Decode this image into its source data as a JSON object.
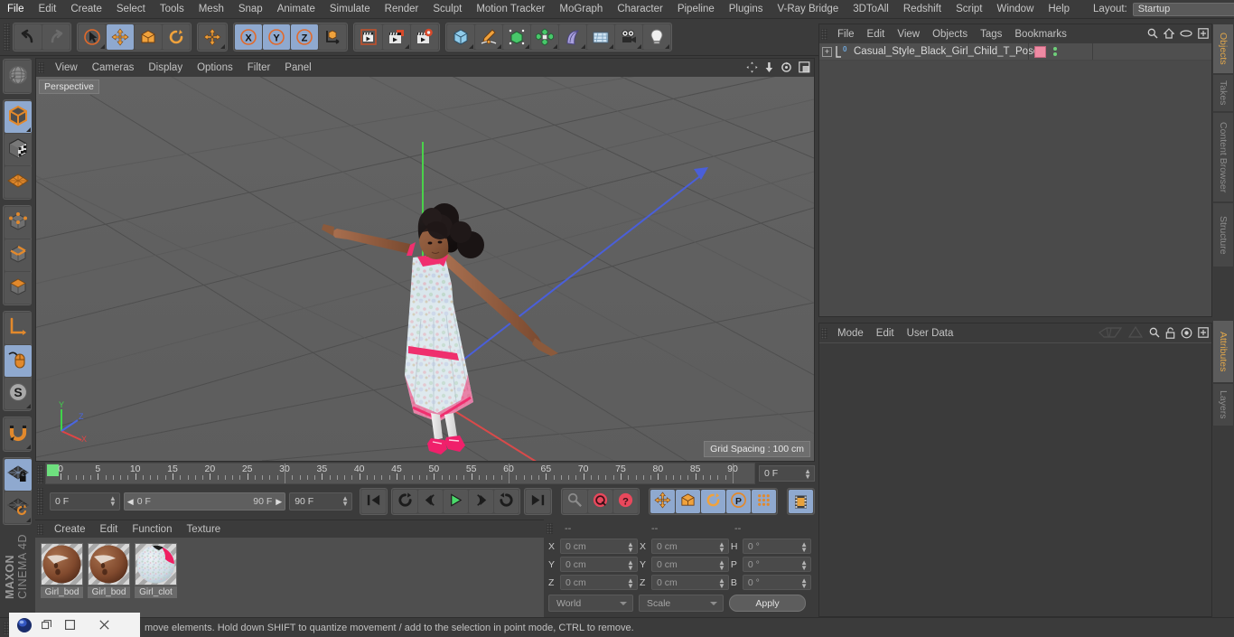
{
  "menubar": {
    "items": [
      "File",
      "Edit",
      "Create",
      "Select",
      "Tools",
      "Mesh",
      "Snap",
      "Animate",
      "Simulate",
      "Render",
      "Sculpt",
      "Motion Tracker",
      "MoGraph",
      "Character",
      "Pipeline",
      "Plugins",
      "V-Ray Bridge",
      "3DToAll",
      "Redshift",
      "Script",
      "Window",
      "Help"
    ],
    "layout_label": "Layout:",
    "layout_value": "Startup",
    "search_icon": "search-icon"
  },
  "toolbar": {
    "groups": [
      {
        "name": "undo-redo",
        "buttons": [
          {
            "name": "undo-button",
            "icon": "undo-arrow-icon",
            "selected": false,
            "corner": false
          },
          {
            "name": "redo-button",
            "icon": "redo-arrow-icon",
            "selected": false,
            "corner": false
          }
        ]
      },
      {
        "name": "transform-tools",
        "buttons": [
          {
            "name": "live-selection-tool",
            "icon": "cursor-circle-icon",
            "selected": false,
            "corner": true
          },
          {
            "name": "move-tool",
            "icon": "move-arrows-icon",
            "selected": true,
            "corner": false
          },
          {
            "name": "scale-tool",
            "icon": "scale-box-icon",
            "selected": false,
            "corner": false
          },
          {
            "name": "rotate-tool",
            "icon": "rotate-arc-icon",
            "selected": false,
            "corner": false
          }
        ]
      },
      {
        "name": "move-dup",
        "buttons": [
          {
            "name": "move-tool-secondary",
            "icon": "move-arrows-icon",
            "selected": false,
            "corner": true
          }
        ]
      },
      {
        "name": "axis-locks",
        "buttons": [
          {
            "name": "lock-x-axis-button",
            "icon": "x-axis-icon",
            "selected": true,
            "corner": false
          },
          {
            "name": "lock-y-axis-button",
            "icon": "y-axis-icon",
            "selected": true,
            "corner": false
          },
          {
            "name": "lock-z-axis-button",
            "icon": "z-axis-icon",
            "selected": true,
            "corner": false
          },
          {
            "name": "world-object-coord-button",
            "icon": "world-axis-cube-icon",
            "selected": false,
            "corner": false
          }
        ]
      },
      {
        "name": "render-tools",
        "buttons": [
          {
            "name": "render-view-button",
            "icon": "clapper-view-icon",
            "selected": false,
            "corner": false
          },
          {
            "name": "render-to-picture-viewer-button",
            "icon": "clapper-picture-icon",
            "selected": false,
            "corner": true
          },
          {
            "name": "render-settings-button",
            "icon": "clapper-gear-icon",
            "selected": false,
            "corner": false
          }
        ]
      },
      {
        "name": "creation-tools",
        "buttons": [
          {
            "name": "add-cube-button",
            "icon": "blue-cube-icon",
            "selected": false,
            "corner": true
          },
          {
            "name": "add-spline-button",
            "icon": "pen-spline-icon",
            "selected": false,
            "corner": true
          },
          {
            "name": "add-generator-button",
            "icon": "green-cube-generator-icon",
            "selected": false,
            "corner": true
          },
          {
            "name": "add-modeling-object-button",
            "icon": "green-array-icon",
            "selected": false,
            "corner": true
          },
          {
            "name": "add-deformer-button",
            "icon": "purple-bend-icon",
            "selected": false,
            "corner": true
          },
          {
            "name": "add-environment-button",
            "icon": "grid-floor-icon",
            "selected": false,
            "corner": true
          },
          {
            "name": "add-camera-button",
            "icon": "camera-icon",
            "selected": false,
            "corner": true
          },
          {
            "name": "add-light-button",
            "icon": "lightbulb-icon",
            "selected": false,
            "corner": true
          }
        ]
      }
    ]
  },
  "leftbar": {
    "groups": [
      {
        "name": "viewport-nav-group",
        "buttons": [
          {
            "name": "undo-view-button",
            "icon": "globe-wire-icon",
            "selected": false,
            "corner": false
          }
        ]
      },
      {
        "name": "editor-mode-group",
        "buttons": [
          {
            "name": "make-editable-button",
            "icon": "orange-cube-convert-icon",
            "selected": true,
            "corner": true
          },
          {
            "name": "texture-mode-button",
            "icon": "checker-cube-icon",
            "selected": false,
            "corner": false
          },
          {
            "name": "viewport-solo-button",
            "icon": "orange-plane-grid-icon",
            "selected": false,
            "corner": false
          }
        ]
      },
      {
        "name": "component-mode-group",
        "buttons": [
          {
            "name": "points-mode-button",
            "icon": "points-cube-icon",
            "selected": false,
            "corner": false
          },
          {
            "name": "edges-mode-button",
            "icon": "edges-cube-icon",
            "selected": false,
            "corner": false
          },
          {
            "name": "polygons-mode-button",
            "icon": "polygons-cube-icon",
            "selected": false,
            "corner": false
          }
        ]
      },
      {
        "name": "axis-group",
        "buttons": [
          {
            "name": "enable-axis-modification-button",
            "icon": "axis-L-icon",
            "selected": false,
            "corner": false
          },
          {
            "name": "viewport-solo-mouse-button",
            "icon": "mouse-icon",
            "selected": true,
            "corner": false
          },
          {
            "name": "soft-selection-button",
            "icon": "s-circle-icon",
            "selected": false,
            "corner": true
          }
        ]
      },
      {
        "name": "snap-group",
        "buttons": [
          {
            "name": "enable-snap-button",
            "icon": "magnet-icon",
            "selected": false,
            "corner": true
          }
        ]
      },
      {
        "name": "workplane-group",
        "buttons": [
          {
            "name": "lock-workplane-button",
            "icon": "workplane-lock-icon",
            "selected": true,
            "corner": false
          },
          {
            "name": "reset-workplane-button",
            "icon": "workplane-reset-icon",
            "selected": false,
            "corner": true
          }
        ]
      }
    ],
    "brand_line1": "MAXON",
    "brand_line2": "CINEMA 4D"
  },
  "viewport": {
    "menu_items": [
      "View",
      "Cameras",
      "Display",
      "Options",
      "Filter",
      "Panel"
    ],
    "label": "Perspective",
    "grid_spacing": "Grid Spacing : 100 cm",
    "axis_labels": {
      "x": "X",
      "y": "Y",
      "z": "Z"
    },
    "corner_icons": [
      "pan-icon",
      "zoom-icon",
      "orbit-icon",
      "maximize-viewport-icon"
    ]
  },
  "timeline": {
    "ticks": [
      0,
      5,
      10,
      15,
      20,
      25,
      30,
      35,
      40,
      45,
      50,
      55,
      60,
      65,
      70,
      75,
      80,
      85,
      90
    ],
    "current_frame_field": "0 F",
    "current_frame_field_right": "0 F",
    "range_start": "0 F",
    "range_end": "90 F",
    "end_frame_field": "90 F",
    "transport": [
      {
        "name": "go-to-start-button",
        "icon": "skip-start-icon",
        "selected": false
      },
      {
        "name": "play-backwards-loop-button",
        "icon": "loop-back-icon",
        "selected": false
      },
      {
        "name": "step-back-button",
        "icon": "step-back-icon",
        "selected": false
      },
      {
        "name": "play-button",
        "icon": "play-icon",
        "selected": false
      },
      {
        "name": "step-forward-button",
        "icon": "step-forward-icon",
        "selected": false
      },
      {
        "name": "play-forward-loop-button",
        "icon": "loop-forward-icon",
        "selected": false
      },
      {
        "name": "go-to-end-button",
        "icon": "skip-end-icon",
        "selected": false
      }
    ],
    "keyframe_buttons": [
      {
        "name": "record-active-objects-button",
        "icon": "key-icon",
        "selected": false
      },
      {
        "name": "autokeying-button",
        "icon": "red-circle-key-icon",
        "selected": false
      },
      {
        "name": "keyframe-selection-button",
        "icon": "red-question-key-icon",
        "selected": false
      }
    ],
    "key_filter_buttons": [
      {
        "name": "position-key-button",
        "icon": "move-arrows-icon",
        "selected": true
      },
      {
        "name": "scale-key-button",
        "icon": "scale-box-icon",
        "selected": true
      },
      {
        "name": "rotation-key-button",
        "icon": "rotate-arc-icon",
        "selected": true
      },
      {
        "name": "parameter-key-button",
        "icon": "p-circle-icon",
        "selected": true
      },
      {
        "name": "point-level-animation-button",
        "icon": "dots-grid-icon",
        "selected": true
      }
    ],
    "timeline_toggle": {
      "name": "toggle-timeline-button",
      "icon": "filmstrip-icon",
      "selected": true
    }
  },
  "material_manager": {
    "menu_items": [
      "Create",
      "Edit",
      "Function",
      "Texture"
    ],
    "materials": [
      {
        "name": "Girl_bod",
        "type": "skin"
      },
      {
        "name": "Girl_bod",
        "type": "skin"
      },
      {
        "name": "Girl_clot",
        "type": "cloth"
      }
    ]
  },
  "coordinates": {
    "headers": [
      "--",
      "--",
      "--"
    ],
    "rows": [
      {
        "label_pos": "X",
        "value_pos": "0 cm",
        "label_size": "X",
        "value_size": "0 cm",
        "label_rot": "H",
        "value_rot": "0 °"
      },
      {
        "label_pos": "Y",
        "value_pos": "0 cm",
        "label_size": "Y",
        "value_size": "0 cm",
        "label_rot": "P",
        "value_rot": "0 °"
      },
      {
        "label_pos": "Z",
        "value_pos": "0 cm",
        "label_size": "Z",
        "value_size": "0 cm",
        "label_rot": "B",
        "value_rot": "0 °"
      }
    ],
    "coord_system": "World",
    "transform_mode": "Scale",
    "apply_label": "Apply"
  },
  "object_manager": {
    "menu_items": [
      "File",
      "Edit",
      "View",
      "Objects",
      "Tags",
      "Bookmarks"
    ],
    "icons": [
      "search-icon",
      "home-icon",
      "ellipse-icon",
      "add-layer-icon"
    ],
    "objects": [
      {
        "name": "Casual_Style_Black_Girl_Child_T_Pose",
        "expandable": true,
        "tag_color": "#ef8aa3"
      }
    ]
  },
  "attributes": {
    "menu_items": [
      "Mode",
      "Edit",
      "User Data"
    ],
    "icons": [
      "prev-attr-icon",
      "next-attr-icon",
      "search-icon",
      "lock-icon",
      "target-icon",
      "add-tab-icon"
    ]
  },
  "right_tabs_top": [
    {
      "label": "Objects",
      "active": true
    },
    {
      "label": "Takes",
      "active": false
    },
    {
      "label": "Content Browser",
      "active": false
    },
    {
      "label": "Structure",
      "active": false
    }
  ],
  "right_tabs_bottom": [
    {
      "label": "Attributes",
      "active": true
    },
    {
      "label": "Layers",
      "active": false
    }
  ],
  "statusbar": {
    "text": "move elements. Hold down SHIFT to quantize movement / add to the selection in point mode, CTRL to remove."
  },
  "taskbar": {
    "app_icon": "cinema4d-app-icon",
    "restore_icon": "restore-window-icon",
    "maximize_icon": "maximize-window-icon",
    "close_icon": "close-window-icon"
  },
  "colors": {
    "accent_orange": "#e0a64b",
    "selected_blue": "#8fa9cf",
    "panel_bg": "#3b3b3b",
    "viewport_bg": "#616161",
    "axis_x": "#d94a4a",
    "axis_y": "#4ad14a",
    "axis_z": "#4a6ad9"
  }
}
